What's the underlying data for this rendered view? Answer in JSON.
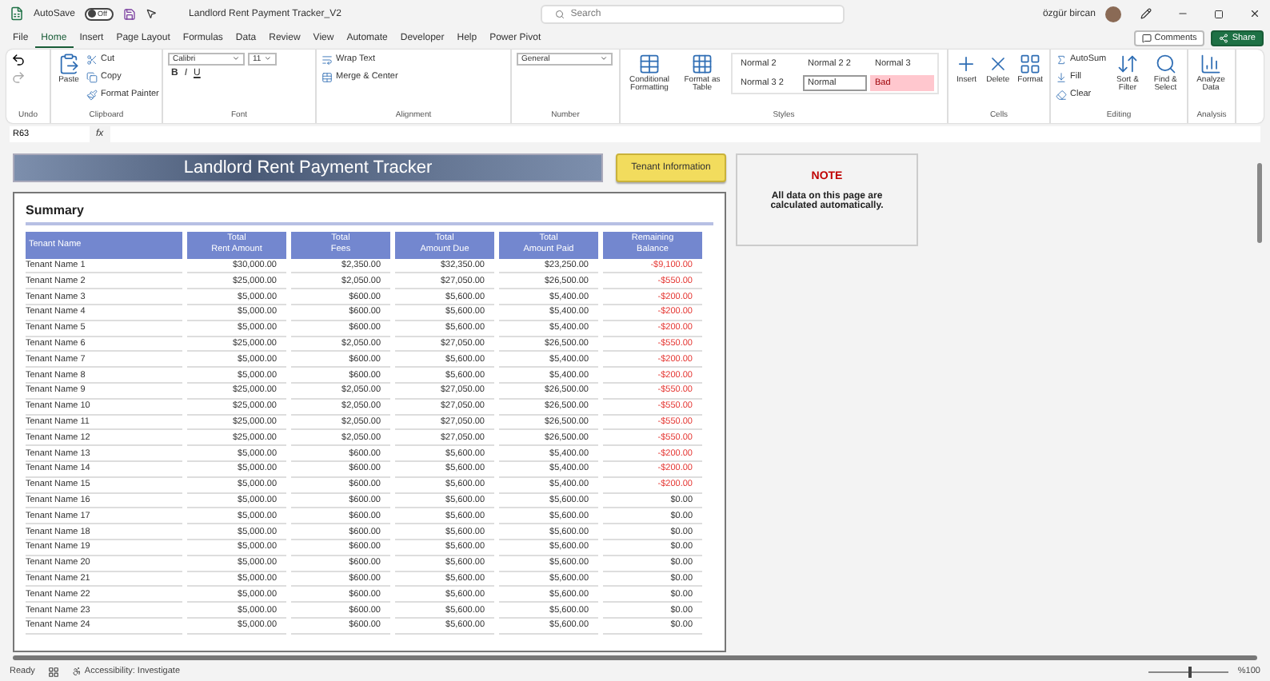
{
  "title_bar": {
    "autosave_label": "AutoSave",
    "autosave": {
      "on": false,
      "label": "Off"
    },
    "file_name": "Landlord Rent Payment Tracker_V2",
    "search": {
      "placeholder": "Search"
    },
    "user": "özgür bircan"
  },
  "menu_tabs": [
    {
      "label": "File",
      "selected": false
    },
    {
      "label": "Home",
      "selected": true
    },
    {
      "label": "Insert",
      "selected": false
    },
    {
      "label": "Page Layout",
      "selected": false
    },
    {
      "label": "Formulas",
      "selected": false
    },
    {
      "label": "Data",
      "selected": false
    },
    {
      "label": "Review",
      "selected": false
    },
    {
      "label": "View",
      "selected": false
    },
    {
      "label": "Automate",
      "selected": false
    },
    {
      "label": "Developer",
      "selected": false
    },
    {
      "label": "Help",
      "selected": false
    },
    {
      "label": "Power Pivot",
      "selected": false
    }
  ],
  "top_buttons": [
    {
      "kind": "plain",
      "label": "Comments"
    },
    {
      "kind": "primary",
      "label": "Share"
    }
  ],
  "ribbon": [
    {
      "label": "Undo"
    },
    {
      "label": "Clipboard",
      "items": [
        {
          "kind": "big",
          "label": "Paste"
        },
        {
          "kind": "small",
          "label": "Cut"
        },
        {
          "kind": "small",
          "label": "Copy"
        },
        {
          "kind": "small",
          "label": "Format Painter"
        }
      ]
    },
    {
      "label": "Font",
      "items": [
        {
          "kind": "field",
          "label": "Calibri"
        },
        {
          "kind": "field",
          "label": "11"
        },
        {
          "kind": "glyphs",
          "labels": [
            "B",
            "I",
            "U"
          ]
        }
      ]
    },
    {
      "label": "Alignment",
      "items": [
        {
          "kind": "small",
          "label": "Wrap Text"
        },
        {
          "kind": "small",
          "label": "Merge & Center"
        }
      ]
    },
    {
      "label": "Number",
      "items": [
        {
          "kind": "field",
          "label": "General"
        }
      ]
    },
    {
      "label": "Styles",
      "items": [
        {
          "kind": "big",
          "label": "Conditional Formatting"
        },
        {
          "kind": "big",
          "label": "Format as Table"
        },
        {
          "kind": "gallery",
          "styles": [
            {
              "label": "Normal 2",
              "kind": "plain"
            },
            {
              "label": "Normal 2 2",
              "kind": "plain"
            },
            {
              "label": "Normal 3",
              "kind": "plain"
            },
            {
              "label": "Normal 3 2",
              "kind": "plain"
            },
            {
              "label": "Normal",
              "kind": "boxed"
            },
            {
              "label": "Bad",
              "kind": "bad"
            }
          ]
        }
      ]
    },
    {
      "label": "Cells",
      "items": [
        {
          "kind": "big",
          "label": "Insert"
        },
        {
          "kind": "big",
          "label": "Delete"
        },
        {
          "kind": "big",
          "label": "Format"
        }
      ]
    },
    {
      "label": "Editing",
      "items": [
        {
          "kind": "small",
          "label": "AutoSum"
        },
        {
          "kind": "small",
          "label": "Fill"
        },
        {
          "kind": "small",
          "label": "Clear"
        },
        {
          "kind": "big",
          "label": "Sort & Filter"
        },
        {
          "kind": "big",
          "label": "Find & Select"
        }
      ]
    },
    {
      "label": "Analysis",
      "items": [
        {
          "kind": "big",
          "label": "Analyze Data"
        }
      ]
    }
  ],
  "formula_bar": {
    "name_box": "R63",
    "fx": "fx"
  },
  "sheet": {
    "title": "Landlord Rent Payment Tracker",
    "tenant_button": "Tenant Information",
    "summary": "Summary",
    "columns": [
      "Tenant Name",
      "Total\nRent Amount",
      "Total\nFees",
      "Total\nAmount Due",
      "Total\nAmount Paid",
      "Remaining\nBalance"
    ],
    "rows": [
      {
        "cells": [
          "Tenant Name 1",
          "$30,000.00",
          "$2,350.00",
          "$32,350.00",
          "$23,250.00",
          "-$9,100.00"
        ],
        "overdue": true
      },
      {
        "cells": [
          "Tenant Name 2",
          "$25,000.00",
          "$2,050.00",
          "$27,050.00",
          "$26,500.00",
          "-$550.00"
        ],
        "overdue": true
      },
      {
        "cells": [
          "Tenant Name 3",
          "$5,000.00",
          "$600.00",
          "$5,600.00",
          "$5,400.00",
          "-$200.00"
        ],
        "overdue": true
      },
      {
        "cells": [
          "Tenant Name 4",
          "$5,000.00",
          "$600.00",
          "$5,600.00",
          "$5,400.00",
          "-$200.00"
        ],
        "overdue": true
      },
      {
        "cells": [
          "Tenant Name 5",
          "$5,000.00",
          "$600.00",
          "$5,600.00",
          "$5,400.00",
          "-$200.00"
        ],
        "overdue": true
      },
      {
        "cells": [
          "Tenant Name 6",
          "$25,000.00",
          "$2,050.00",
          "$27,050.00",
          "$26,500.00",
          "-$550.00"
        ],
        "overdue": true
      },
      {
        "cells": [
          "Tenant Name 7",
          "$5,000.00",
          "$600.00",
          "$5,600.00",
          "$5,400.00",
          "-$200.00"
        ],
        "overdue": true
      },
      {
        "cells": [
          "Tenant Name 8",
          "$5,000.00",
          "$600.00",
          "$5,600.00",
          "$5,400.00",
          "-$200.00"
        ],
        "overdue": true
      },
      {
        "cells": [
          "Tenant Name 9",
          "$25,000.00",
          "$2,050.00",
          "$27,050.00",
          "$26,500.00",
          "-$550.00"
        ],
        "overdue": true
      },
      {
        "cells": [
          "Tenant Name 10",
          "$25,000.00",
          "$2,050.00",
          "$27,050.00",
          "$26,500.00",
          "-$550.00"
        ],
        "overdue": true
      },
      {
        "cells": [
          "Tenant Name 11",
          "$25,000.00",
          "$2,050.00",
          "$27,050.00",
          "$26,500.00",
          "-$550.00"
        ],
        "overdue": true
      },
      {
        "cells": [
          "Tenant Name 12",
          "$25,000.00",
          "$2,050.00",
          "$27,050.00",
          "$26,500.00",
          "-$550.00"
        ],
        "overdue": true
      },
      {
        "cells": [
          "Tenant Name 13",
          "$5,000.00",
          "$600.00",
          "$5,600.00",
          "$5,400.00",
          "-$200.00"
        ],
        "overdue": true
      },
      {
        "cells": [
          "Tenant Name 14",
          "$5,000.00",
          "$600.00",
          "$5,600.00",
          "$5,400.00",
          "-$200.00"
        ],
        "overdue": true
      },
      {
        "cells": [
          "Tenant Name 15",
          "$5,000.00",
          "$600.00",
          "$5,600.00",
          "$5,400.00",
          "-$200.00"
        ],
        "overdue": true
      },
      {
        "cells": [
          "Tenant Name 16",
          "$5,000.00",
          "$600.00",
          "$5,600.00",
          "$5,600.00",
          "$0.00"
        ],
        "overdue": false
      },
      {
        "cells": [
          "Tenant Name 17",
          "$5,000.00",
          "$600.00",
          "$5,600.00",
          "$5,600.00",
          "$0.00"
        ],
        "overdue": false
      },
      {
        "cells": [
          "Tenant Name 18",
          "$5,000.00",
          "$600.00",
          "$5,600.00",
          "$5,600.00",
          "$0.00"
        ],
        "overdue": false
      },
      {
        "cells": [
          "Tenant Name 19",
          "$5,000.00",
          "$600.00",
          "$5,600.00",
          "$5,600.00",
          "$0.00"
        ],
        "overdue": false
      },
      {
        "cells": [
          "Tenant Name 20",
          "$5,000.00",
          "$600.00",
          "$5,600.00",
          "$5,600.00",
          "$0.00"
        ],
        "overdue": false
      },
      {
        "cells": [
          "Tenant Name 21",
          "$5,000.00",
          "$600.00",
          "$5,600.00",
          "$5,600.00",
          "$0.00"
        ],
        "overdue": false
      },
      {
        "cells": [
          "Tenant Name 22",
          "$5,000.00",
          "$600.00",
          "$5,600.00",
          "$5,600.00",
          "$0.00"
        ],
        "overdue": false
      },
      {
        "cells": [
          "Tenant Name 23",
          "$5,000.00",
          "$600.00",
          "$5,600.00",
          "$5,600.00",
          "$0.00"
        ],
        "overdue": false
      },
      {
        "cells": [
          "Tenant Name 24",
          "$5,000.00",
          "$600.00",
          "$5,600.00",
          "$5,600.00",
          "$0.00"
        ],
        "overdue": false
      }
    ],
    "note": {
      "title": "NOTE",
      "text": "All data on this page are calculated automatically."
    }
  },
  "status_bar": {
    "ready": "Ready",
    "accessibility": "Accessibility: Investigate",
    "zoom": {
      "label": "%100",
      "level": 0.5
    }
  }
}
